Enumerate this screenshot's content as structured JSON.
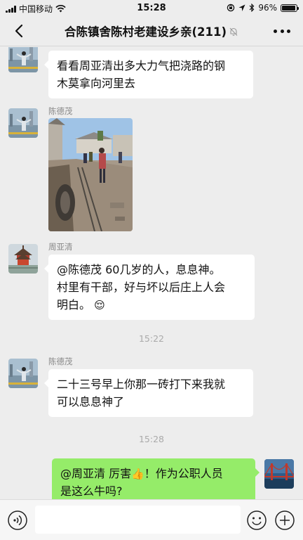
{
  "status_bar": {
    "carrier": "中国移动",
    "time": "15:28",
    "battery_text": "96%",
    "battery_level": 0.96,
    "icons": [
      "signal-icon",
      "wifi-icon",
      "orientation-lock-icon",
      "location-icon",
      "bluetooth-icon",
      "battery-icon"
    ]
  },
  "nav": {
    "title": "合陈镇舍陈村老建设乡亲(211)",
    "back_icon": "chevron-left-icon",
    "mute_icon": "bell-muted-icon",
    "more_icon": "more-dots-icon"
  },
  "messages": [
    {
      "side": "left",
      "sender": "",
      "text": [
        "看看周亚清出多大力气把浇路的钢",
        "木莫拿向河里去"
      ]
    },
    {
      "side": "left",
      "sender": "陈德茂",
      "type": "image"
    },
    {
      "side": "left",
      "sender": "周亚清",
      "text": [
        "@陈德茂 60几岁的人，息息神。",
        "村里有干部，好与坏以后庄上人会",
        "明白。"
      ],
      "emoji": "😌"
    },
    {
      "type": "time",
      "text": "15:22"
    },
    {
      "side": "left",
      "sender": "陈德茂",
      "text": [
        "二十三号早上你那一砖打下来我就",
        "可以息息神了"
      ]
    },
    {
      "type": "time",
      "text": "15:28"
    },
    {
      "side": "right",
      "sender": "",
      "text": [
        "@周亚清  厉害",
        "！作为公职人员",
        "是这么牛吗?"
      ],
      "emoji": "👍"
    }
  ],
  "input_bar": {
    "placeholder": "",
    "voice_icon": "voice-icon",
    "emoji_icon": "smiley-icon",
    "plus_icon": "plus-icon"
  },
  "colors": {
    "background": "#ededed",
    "bubble_left": "#ffffff",
    "bubble_right": "#95ec69",
    "timestamp": "#aaaaaa"
  }
}
